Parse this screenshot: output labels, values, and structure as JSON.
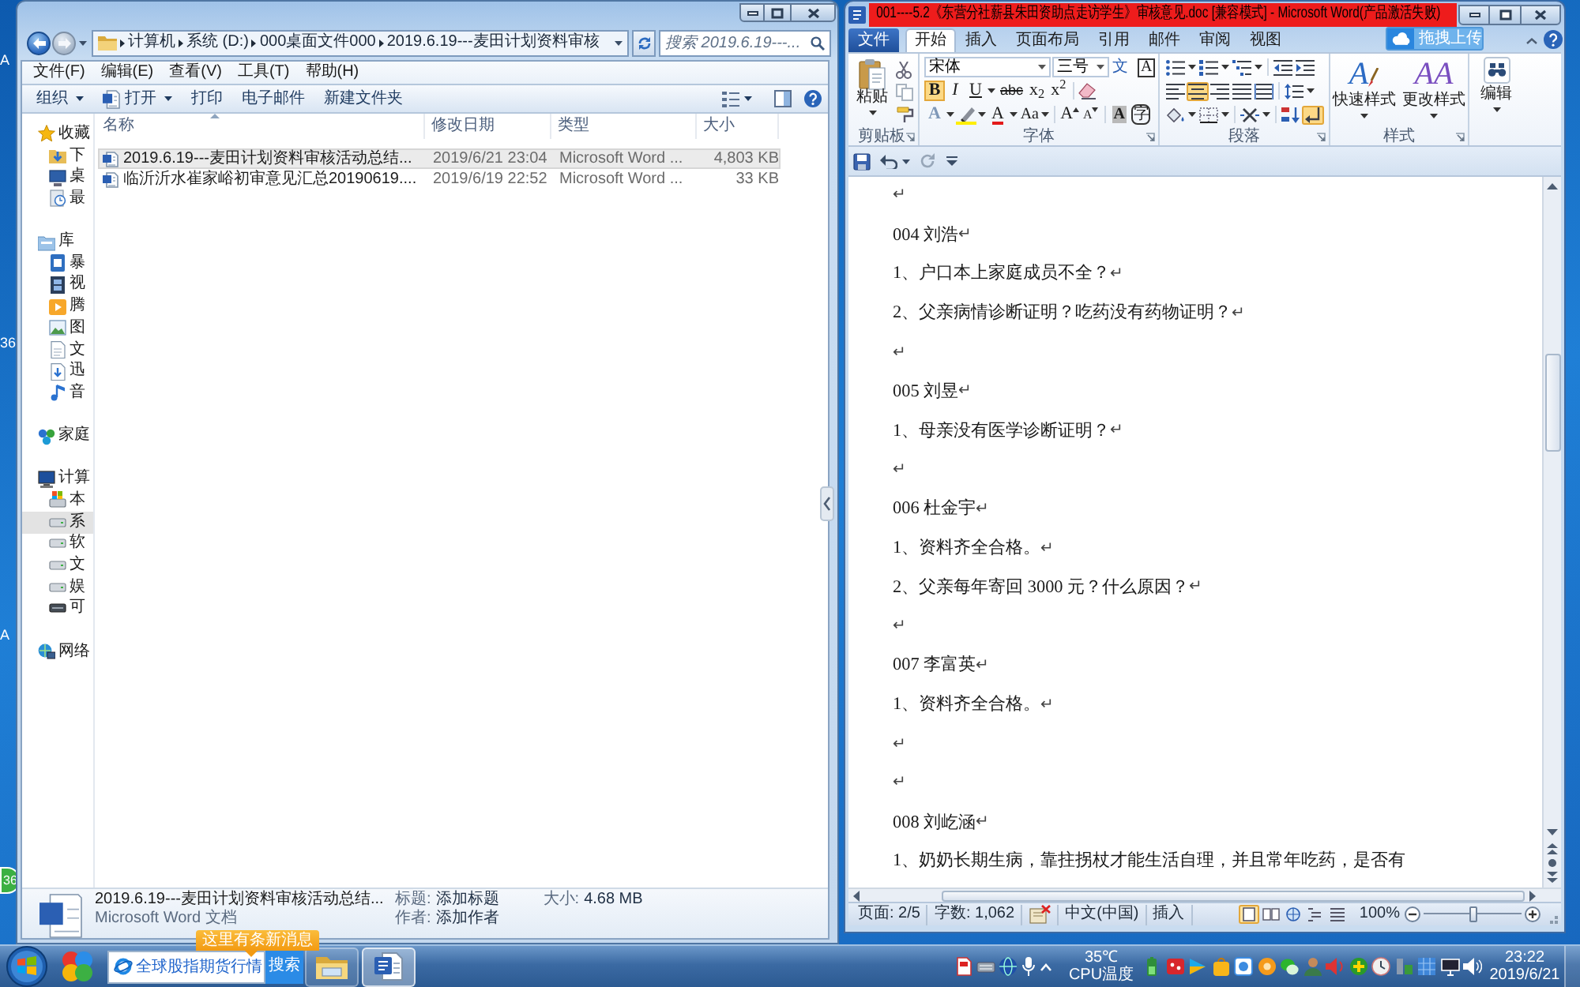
{
  "desktop": {
    "labels": [
      "A",
      "36",
      "A"
    ],
    "badge": "36"
  },
  "explorer": {
    "address": [
      "计算机",
      "系统 (D:)",
      "000桌面文件000",
      "2019.6.19---麦田计划资料审核"
    ],
    "search": {
      "placeholder": "搜索 2019.6.19---..."
    },
    "menu": [
      "文件(F)",
      "编辑(E)",
      "查看(V)",
      "工具(T)",
      "帮助(H)"
    ],
    "toolbar": [
      {
        "label": "组织",
        "kind": "menu"
      },
      {
        "label": "打开",
        "kind": "open"
      },
      {
        "label": "打印",
        "kind": "plain"
      },
      {
        "label": "电子邮件",
        "kind": "plain"
      },
      {
        "label": "新建文件夹",
        "kind": "plain"
      }
    ],
    "nav": [
      {
        "label": "收藏",
        "kind": "star",
        "selected": false,
        "children": [
          {
            "label": "下",
            "kind": "download",
            "selected": false
          },
          {
            "label": "桌",
            "kind": "desktop",
            "selected": false
          },
          {
            "label": "最",
            "kind": "recent",
            "selected": false
          }
        ]
      },
      {
        "label": "库",
        "kind": "library",
        "selected": false,
        "children": [
          {
            "label": "暴",
            "kind": "media",
            "selected": false
          },
          {
            "label": "视",
            "kind": "video",
            "selected": false
          },
          {
            "label": "腾",
            "kind": "app",
            "selected": false
          },
          {
            "label": "图",
            "kind": "picture",
            "selected": false
          },
          {
            "label": "文",
            "kind": "document",
            "selected": false
          },
          {
            "label": "迅",
            "kind": "download-doc",
            "selected": false
          },
          {
            "label": "音",
            "kind": "music",
            "selected": false
          }
        ]
      },
      {
        "label": "家庭",
        "kind": "homegroup",
        "selected": false
      },
      {
        "label": "计算",
        "kind": "computer",
        "selected": false,
        "children": [
          {
            "label": "本",
            "kind": "system-drive",
            "selected": false
          },
          {
            "label": "系",
            "kind": "drive",
            "selected": true
          },
          {
            "label": "软",
            "kind": "drive",
            "selected": false
          },
          {
            "label": "文",
            "kind": "drive",
            "selected": false
          },
          {
            "label": "娱",
            "kind": "drive",
            "selected": false
          },
          {
            "label": "可",
            "kind": "removable",
            "selected": false
          }
        ]
      },
      {
        "label": "网络",
        "kind": "network",
        "selected": false
      }
    ],
    "columns": [
      "名称",
      "修改日期",
      "类型",
      "大小"
    ],
    "files": [
      {
        "name": "2019.6.19---麦田计划资料审核活动总结...",
        "modified": "2019/6/21 23:04",
        "type": "Microsoft Word ...",
        "size": "4,803 KB",
        "selected": true
      },
      {
        "name": "临沂沂水崔家峪初审意见汇总20190619....",
        "modified": "2019/6/19 22:52",
        "type": "Microsoft Word ...",
        "size": "33 KB",
        "selected": false
      }
    ],
    "details": {
      "name": "2019.6.19---麦田计划资料审核活动总结...",
      "type": "Microsoft Word 文档",
      "fields": [
        {
          "label": "标题:",
          "value": "添加标题"
        },
        {
          "label": "作者:",
          "value": "添加作者"
        },
        {
          "label": "大小:",
          "value": "4.68 MB"
        }
      ]
    }
  },
  "word": {
    "title": "001----5.2《东营分社薪县朱田资助点走访学生》审核意见.doc [兼容模式] - Microsoft Word(产品激活失败)",
    "file_tab": "文件",
    "tabs": [
      {
        "label": "开始",
        "selected": true
      },
      {
        "label": "插入",
        "selected": false
      },
      {
        "label": "页面布局",
        "selected": false
      },
      {
        "label": "引用",
        "selected": false
      },
      {
        "label": "邮件",
        "selected": false
      },
      {
        "label": "审阅",
        "selected": false
      },
      {
        "label": "视图",
        "selected": false
      }
    ],
    "upload_button": "拖拽上传",
    "clipboard": {
      "label": "剪贴板",
      "paste": "粘贴"
    },
    "font": {
      "label": "字体",
      "family": "宋体",
      "size": "三号",
      "row1": [
        {
          "glyph": "文",
          "kind": "phonetic"
        },
        {
          "glyph": "A",
          "kind": "border"
        }
      ],
      "row2": [
        {
          "glyph": "B",
          "kind": "bold",
          "selected": true
        },
        {
          "glyph": "I",
          "kind": "italic",
          "selected": false
        },
        {
          "glyph": "U",
          "kind": "underline",
          "selected": false
        },
        {
          "glyph": "abc",
          "kind": "strike",
          "selected": false
        },
        {
          "glyph": "x$_{2}$",
          "kind": "subscript",
          "selected": false
        },
        {
          "glyph": "x$^{2}$",
          "kind": "superscript",
          "selected": false
        },
        {
          "kind": "clear"
        }
      ],
      "row3": [
        {
          "glyph": "A",
          "kind": "effects"
        },
        {
          "kind": "highlight"
        },
        {
          "glyph": "A",
          "kind": "color"
        },
        {
          "glyph": "Aa",
          "kind": "case"
        },
        {
          "glyph": "A",
          "kind": "grow"
        },
        {
          "glyph": "A",
          "kind": "shrink"
        },
        {
          "glyph": "A",
          "kind": "shading"
        },
        {
          "glyph": "字",
          "kind": "enclose"
        }
      ]
    },
    "paragraph": {
      "label": "段落",
      "alignment": [
        {
          "selected": false
        },
        {
          "selected": true
        },
        {
          "selected": false
        },
        {
          "selected": false
        },
        {
          "selected": false
        }
      ],
      "show_marks": {
        "selected": true
      }
    },
    "styles": {
      "label": "样式",
      "buttons": [
        {
          "glyph": "A",
          "label": "快速样式"
        },
        {
          "glyph": "AA",
          "label": "更改样式"
        }
      ]
    },
    "editing": {
      "label": "编辑"
    },
    "document": [
      {
        "mark": "↵"
      },
      {
        "text": "004 刘浩",
        "mark": "↵"
      },
      {
        "text": "1、户口本上家庭成员不全？",
        "mark": "↵"
      },
      {
        "text": "2、父亲病情诊断证明？吃药没有药物证明？",
        "mark": "↵"
      },
      {
        "mark": "↵"
      },
      {
        "text": "005 刘昱",
        "mark": "↵"
      },
      {
        "text": "1、母亲没有医学诊断证明？",
        "mark": "↵"
      },
      {
        "mark": "↵"
      },
      {
        "text": "006 杜金宇",
        "mark": "↵"
      },
      {
        "text": "1、资料齐全合格。",
        "mark": "↵"
      },
      {
        "text": "2、父亲每年寄回 3000 元？什么原因？",
        "mark": "↵"
      },
      {
        "mark": "↵"
      },
      {
        "text": "007 李富英",
        "mark": "↵"
      },
      {
        "text": "1、资料齐全合格。",
        "mark": "↵"
      },
      {
        "mark": "↵"
      },
      {
        "mark": "↵"
      },
      {
        "text": "008 刘屹涵",
        "mark": "↵"
      },
      {
        "text": "1、奶奶长期生病，靠拄拐杖才能生活自理，并且常年吃药，是否有"
      }
    ],
    "status": {
      "page": "页面: 2/5",
      "words": "字数: 1,062",
      "language": "中文(中国)",
      "mode": "插入",
      "views": [
        {
          "selected": true
        },
        {
          "selected": false
        },
        {
          "selected": false
        },
        {
          "selected": false
        },
        {
          "selected": false
        }
      ],
      "zoom": "100%",
      "zoom_slider": {
        "level": 0.5
      }
    }
  },
  "taskbar": {
    "search": {
      "placeholder": "全球股指期货行情",
      "button": "搜索"
    },
    "tooltip": "这里有条新消息",
    "apps": [
      {
        "kind": "folder",
        "selected": false
      },
      {
        "kind": "document",
        "selected": true
      }
    ],
    "temperature": "35℃",
    "temperature_label": "CPU温度",
    "time": "23:22",
    "date": "2019/6/21"
  }
}
